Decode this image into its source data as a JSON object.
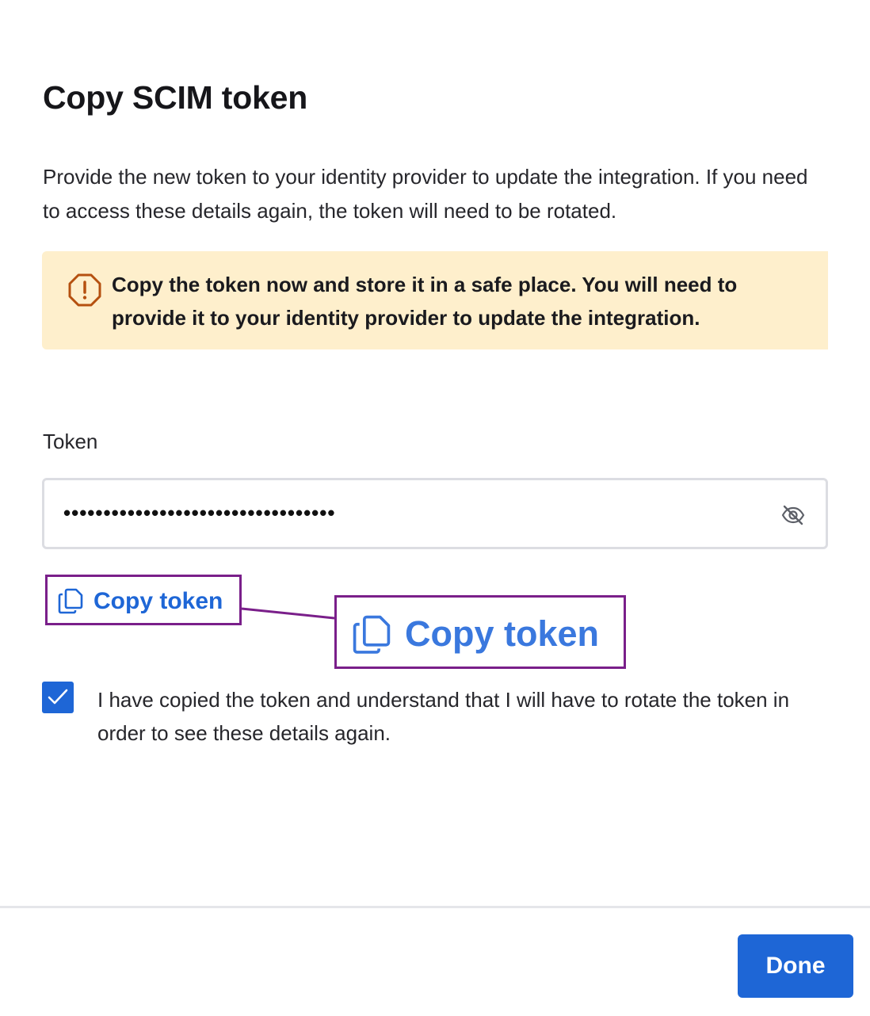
{
  "dialog": {
    "title": "Copy SCIM token",
    "description": "Provide the new token to your identity provider to update the integration. If you need to access these details again, the token will need to be rotated.",
    "warning": {
      "icon": "warning-octagon-icon",
      "text": "Copy the token now and store it in a safe place. You will need to provide it to your identity provider to update the integration."
    },
    "token_field": {
      "label": "Token",
      "value": "••••••••••••••••••••••••••••••••••",
      "visibility_icon": "eye-off-icon"
    },
    "copy_button": {
      "icon": "copy-icon",
      "label": "Copy token"
    },
    "callout": {
      "label": "Copy token"
    },
    "acknowledge": {
      "checked": true,
      "label": "I have copied the token and understand that I will have to rotate the token in order to see these details again."
    },
    "footer": {
      "done_label": "Done"
    }
  },
  "colors": {
    "accent": "#1e66d6",
    "warning_bg": "#feefcc",
    "warning_icon": "#b5500f",
    "annotation_border": "#7a1f8a"
  }
}
